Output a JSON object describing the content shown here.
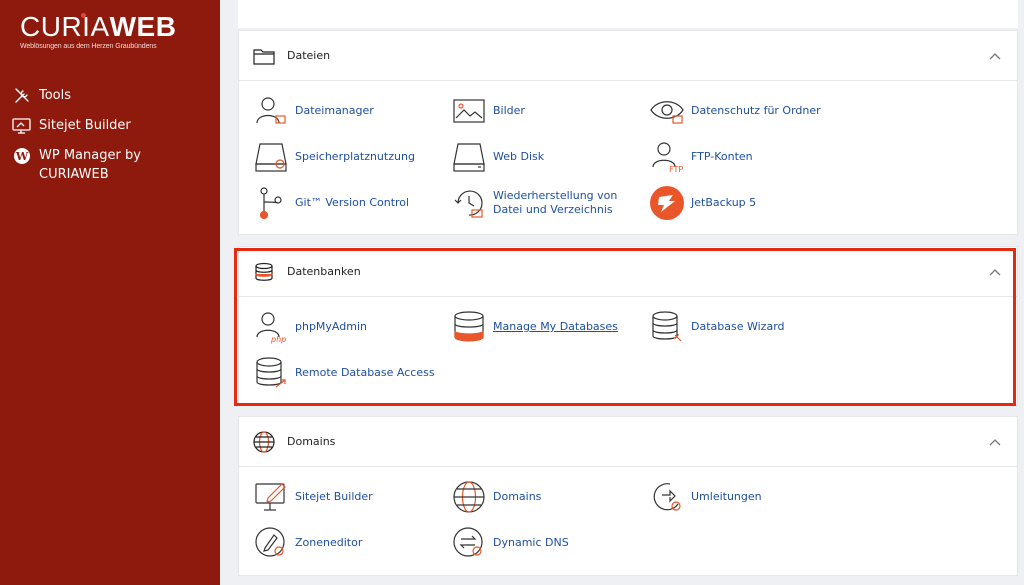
{
  "brand": {
    "name_part1": "CURIA",
    "name_part2": "WEB",
    "tagline": "Weblösungen aus dem Herzen Graubündens"
  },
  "sidebar": {
    "items": [
      {
        "label": "Tools",
        "icon": "tools-icon"
      },
      {
        "label": "Sitejet Builder",
        "icon": "sitejet-icon"
      },
      {
        "label": "WP Manager by CURIAWEB",
        "icon": "wordpress-icon"
      }
    ]
  },
  "sections": [
    {
      "title": "Dateien",
      "icon": "folder-icon",
      "items": [
        {
          "label": "Dateimanager",
          "icon": "file-manager-icon"
        },
        {
          "label": "Bilder",
          "icon": "images-icon"
        },
        {
          "label": "Datenschutz für Ordner",
          "icon": "directory-privacy-icon"
        },
        {
          "label": "Speicherplatznutzung",
          "icon": "disk-usage-icon"
        },
        {
          "label": "Web Disk",
          "icon": "web-disk-icon"
        },
        {
          "label": "FTP-Konten",
          "icon": "ftp-accounts-icon"
        },
        {
          "label": "Git™ Version Control",
          "icon": "git-icon"
        },
        {
          "label": "Wiederherstellung von Datei und Verzeichnis",
          "icon": "restore-icon"
        },
        {
          "label": "JetBackup 5",
          "icon": "jetbackup-icon"
        }
      ]
    },
    {
      "title": "Datenbanken",
      "icon": "database-icon",
      "items": [
        {
          "label": "phpMyAdmin",
          "icon": "phpmyadmin-icon"
        },
        {
          "label": "Manage My Databases",
          "icon": "manage-databases-icon"
        },
        {
          "label": "Database Wizard",
          "icon": "database-wizard-icon"
        },
        {
          "label": "Remote Database Access",
          "icon": "remote-database-icon"
        }
      ]
    },
    {
      "title": "Domains",
      "icon": "globe-icon",
      "items": [
        {
          "label": "Sitejet Builder",
          "icon": "sitejet-builder-icon"
        },
        {
          "label": "Domains",
          "icon": "domains-icon"
        },
        {
          "label": "Umleitungen",
          "icon": "redirects-icon"
        },
        {
          "label": "Zoneneditor",
          "icon": "zone-editor-icon"
        },
        {
          "label": "Dynamic DNS",
          "icon": "dynamic-dns-icon"
        }
      ]
    }
  ],
  "colors": {
    "sidebar_bg": "#8e1a0e",
    "accent_orange": "#e8562a",
    "link_blue": "#1f4fa0",
    "highlight_red": "#e62a12"
  }
}
